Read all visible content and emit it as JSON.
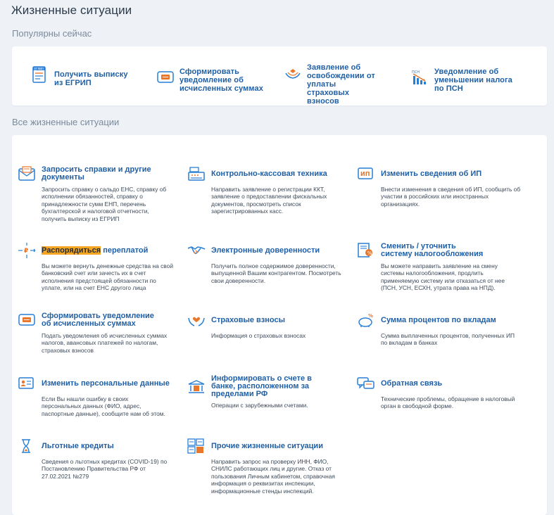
{
  "page_title": "Жизненные ситуации",
  "popular": {
    "title": "Популярны сейчас",
    "items": [
      {
        "label": "Получить выписку из ЕГРИП",
        "icon": "egrip-document-icon"
      },
      {
        "label": "Сформировать уведомление об исчисленных суммах",
        "icon": "notification-envelope-icon"
      },
      {
        "label": "Заявление об освобождении от уплаты страховых взносов",
        "icon": "insurance-hands-icon"
      },
      {
        "label": "Уведомление об уменьшении налога по ПСН",
        "icon": "psn-chart-icon"
      }
    ]
  },
  "all": {
    "title": "Все жизненные ситуации",
    "items": [
      {
        "title": "Запросить справки и другие документы",
        "desc": "Запросить справку о сальдо ЕНС, справку об исполнении обязанностей, справку о принадлежности сумм ЕНП, перечень бухгалтерской и налоговой отчетности, получить выписку из ЕГРИП",
        "icon": "document-envelope-icon"
      },
      {
        "title": "Контрольно-кассовая техника",
        "desc": "Направить заявление о регистрации ККТ, заявление о предоставлении фискальных документов, просмотреть список зарегистрированных касс.",
        "icon": "cash-register-icon"
      },
      {
        "title": "Изменить сведения об ИП",
        "desc": "Внести изменения в сведения об ИП, сообщить об участии в российских или иностранных организациях.",
        "icon": "ip-edit-icon"
      },
      {
        "title_highlight": "Распорядиться",
        "title_rest": " переплатой",
        "desc": "Вы можете вернуть денежные средства на свой банковский счет или зачесть их в счет исполнения предстоящей обязанности по уплате, или на счет ЕНС другого лица",
        "icon": "ruble-arrows-icon"
      },
      {
        "title": "Электронные доверенности",
        "desc": "Получить полное содержимое доверенности, выпущенной Вашим контрагентом. Посмотреть свои доверенности.",
        "icon": "handshake-icon"
      },
      {
        "title": "Сменить / уточнить систему налогообложения",
        "desc": "Вы можете направить заявление на смену системы налогообложения, продлить применяемую систему или отказаться от нее (ПСН, УСН, ЕСХН, утрата права на НПД).",
        "icon": "tax-system-icon"
      },
      {
        "title": "Сформировать уведомление об исчисленных суммах",
        "desc": "Подать уведомления об исчисленных суммах налогов, авансовых платежей по налогам, страховых взносов",
        "icon": "notification-envelope-icon"
      },
      {
        "title": "Страховые взносы",
        "desc": "Информация о страховых взносах",
        "icon": "heart-hands-icon"
      },
      {
        "title": "Сумма процентов по вкладам",
        "desc": "Сумма выплаченных процентов, полученных ИП по вкладам в банках",
        "icon": "piggy-bank-icon"
      },
      {
        "title": "Изменить персональные данные",
        "desc": "Если Вы нашли ошибку в своих персональных данных (ФИО, адрес, паспортные данные), сообщите нам об этом.",
        "icon": "id-card-icon"
      },
      {
        "title": "Информировать о счете в банке, расположенном за пределами РФ",
        "desc": "Операции с зарубежными счетами.",
        "icon": "bank-icon"
      },
      {
        "title": "Обратная связь",
        "desc": "Технические проблемы, обращение в налоговый орган в свободной форме.",
        "icon": "chat-bubbles-icon"
      },
      {
        "title": "Льготные кредиты",
        "desc": "Сведения о льготных кредитах (COVID-19) по Постановлению Правительства РФ от 27.02.2021 №279",
        "icon": "hourglass-icon"
      },
      {
        "title": "Прочие жизненные ситуации",
        "desc": "Направить запрос на проверку ИНН, ФИО, СНИЛС работающих лиц и другие. Отказ от пользования Личным кабинетом, справочная информация о реквизитах инспекции, информационные стенды инспекций.",
        "icon": "grid-documents-icon"
      }
    ]
  },
  "colors": {
    "link": "#1f5fa6",
    "icon_blue": "#2a7fd4",
    "icon_orange": "#e8762b",
    "highlight": "#f5a623",
    "background": "#eef2f7"
  }
}
